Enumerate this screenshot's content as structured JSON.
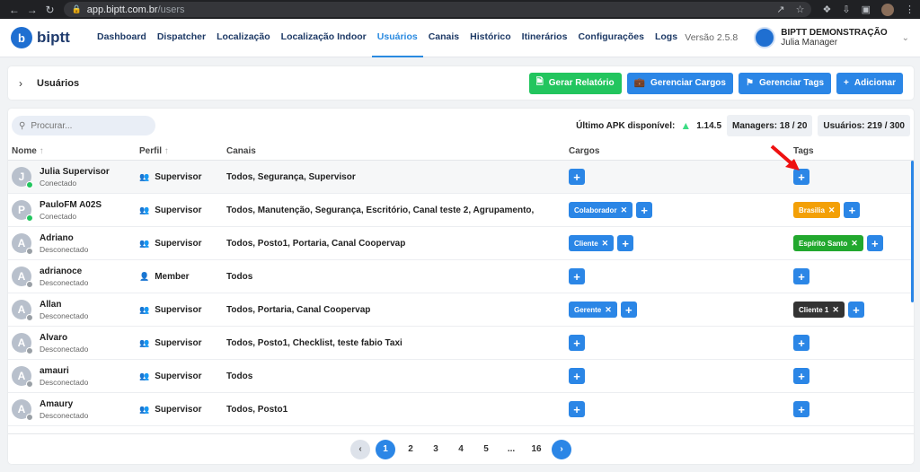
{
  "browser": {
    "host": "app.biptt.com.br",
    "path": "/users"
  },
  "app": {
    "logo_text": "biptt",
    "nav": [
      "Dashboard",
      "Dispatcher",
      "Localização",
      "Localização Indoor",
      "Usuários",
      "Canais",
      "Histórico",
      "Itinerários",
      "Configurações",
      "Logs"
    ],
    "active_nav": "Usuários",
    "version": "Versão 2.5.8",
    "account_name": "BIPTT DEMONSTRAÇÃO",
    "account_user": "Julia Manager"
  },
  "header": {
    "title": "Usuários",
    "buttons": {
      "report": "Gerar Relatório",
      "roles": "Gerenciar Cargos",
      "tags": "Gerenciar Tags",
      "add": "Adicionar"
    }
  },
  "toolbar": {
    "search_placeholder": "Procurar...",
    "apk_label": "Último APK disponível:",
    "apk_version": "1.14.5",
    "managers": "Managers: 18 / 20",
    "users": "Usuários: 219 / 300"
  },
  "table": {
    "headers": {
      "nome": "Nome",
      "perfil": "Perfil",
      "canais": "Canais",
      "cargos": "Cargos",
      "tags": "Tags"
    },
    "rows": [
      {
        "initial": "J",
        "name": "Julia Supervisor",
        "status": "Conectado",
        "online": true,
        "perfil": "Supervisor",
        "canais": "Todos, Segurança, Supervisor",
        "cargos": [],
        "tags": []
      },
      {
        "initial": "P",
        "name": "PauloFM A02S",
        "status": "Conectado",
        "online": true,
        "perfil": "Supervisor",
        "canais": "Todos, Manutenção, Segurança, Escritório, Canal teste 2, Agrupamento,",
        "cargos": [
          "Colaborador"
        ],
        "tags": [
          {
            "label": "Brasilia",
            "color": "orange"
          }
        ]
      },
      {
        "initial": "A",
        "name": "Adriano",
        "status": "Desconectado",
        "online": false,
        "perfil": "Supervisor",
        "canais": "Todos, Posto1, Portaria, Canal Coopervap",
        "cargos": [
          "Cliente"
        ],
        "tags": [
          {
            "label": "Espírito Santo",
            "color": "green"
          }
        ]
      },
      {
        "initial": "A",
        "name": "adrianoce",
        "status": "Desconectado",
        "online": false,
        "perfil": "Member",
        "canais": "Todos",
        "cargos": [],
        "tags": []
      },
      {
        "initial": "A",
        "name": "Allan",
        "status": "Desconectado",
        "online": false,
        "perfil": "Supervisor",
        "canais": "Todos, Portaria, Canal Coopervap",
        "cargos": [
          "Gerente"
        ],
        "tags": [
          {
            "label": "Cliente 1",
            "color": "dark"
          }
        ]
      },
      {
        "initial": "A",
        "name": "Alvaro",
        "status": "Desconectado",
        "online": false,
        "perfil": "Supervisor",
        "canais": "Todos, Posto1, Checklist, teste fabio Taxi",
        "cargos": [],
        "tags": []
      },
      {
        "initial": "A",
        "name": "amauri",
        "status": "Desconectado",
        "online": false,
        "perfil": "Supervisor",
        "canais": "Todos",
        "cargos": [],
        "tags": []
      },
      {
        "initial": "A",
        "name": "Amaury",
        "status": "Desconectado",
        "online": false,
        "perfil": "Supervisor",
        "canais": "Todos, Posto1",
        "cargos": [],
        "tags": []
      }
    ]
  },
  "pagination": {
    "pages": [
      "1",
      "2",
      "3",
      "4",
      "5",
      "...",
      "16"
    ],
    "current": "1"
  }
}
